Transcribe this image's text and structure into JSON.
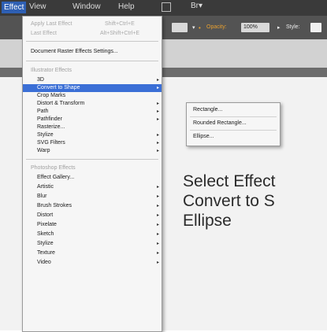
{
  "menubar": {
    "items": [
      "Effect",
      "View",
      "Window",
      "Help"
    ],
    "bridge_icon": "Br▾"
  },
  "control_bar": {
    "opacity_label": "Opacity:",
    "opacity_value": "100%",
    "style_label": "Style:"
  },
  "effect_menu": {
    "apply_last": {
      "label": "Apply Last Effect",
      "shortcut": "Shift+Ctrl+E"
    },
    "last_effect": {
      "label": "Last Effect",
      "shortcut": "Alt+Shift+Ctrl+E"
    },
    "document_raster": "Document Raster Effects Settings...",
    "illustrator_header": "Illustrator Effects",
    "illustrator_items": [
      "3D",
      "Convert to Shape",
      "Crop Marks",
      "Distort & Transform",
      "Path",
      "Pathfinder",
      "Rasterize...",
      "Stylize",
      "SVG Filters",
      "Warp"
    ],
    "photoshop_header": "Photoshop Effects",
    "photoshop_items": [
      "Effect Gallery...",
      "Artistic",
      "Blur",
      "Brush Strokes",
      "Distort",
      "Pixelate",
      "Sketch",
      "Stylize",
      "Texture",
      "Video"
    ]
  },
  "convert_submenu": {
    "items": [
      "Rectangle...",
      "Rounded Rectangle...",
      "Ellipse..."
    ]
  },
  "caption": {
    "line1": "Select Effect",
    "line2": "Convert to S",
    "line3": "Ellipse"
  },
  "colors": {
    "menubar_bg": "#3a3a3a",
    "selection_blue": "#3b6fd6",
    "menu_bg": "#f6f6f6"
  }
}
